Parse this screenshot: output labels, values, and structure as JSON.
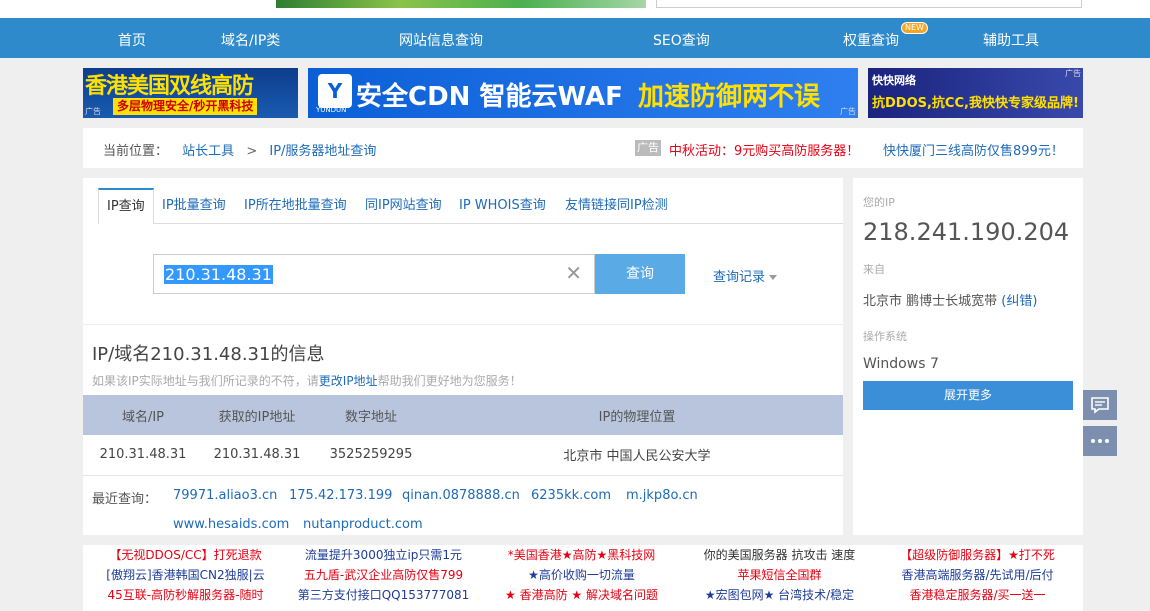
{
  "nav": {
    "items": [
      "首页",
      "域名/IP类",
      "网站信息查询",
      "SEO查询",
      "权重查询",
      "辅助工具"
    ],
    "new_badge": "NEW"
  },
  "ads": {
    "ad1_line1": "香港美国双线高防",
    "ad1_line2": "多层物理安全/秒开黑科技",
    "ad2_logo_text": "YUNDUN",
    "ad2_line1": "安全CDN 智能云WAF",
    "ad2_line2": "加速防御两不误",
    "ad3_brand": "快快网络",
    "ad3_line1": "抗DDOS,抗CC,我快快专家级品牌!",
    "ad_mark": "广告"
  },
  "breadcrumb": {
    "prefix": "当前位置：",
    "home": "站长工具",
    "sep": ">",
    "current": "IP/服务器地址查询",
    "ad_tag": "广告",
    "ad_text1": "中秋活动：9元购买高防服务器！",
    "ad_text2": "快快厦门三线高防仅售899元！"
  },
  "tabs": [
    "IP查询",
    "IP批量查询",
    "IP所在地批量查询",
    "同IP网站查询",
    "IP WHOIS查询",
    "友情链接同IP检测"
  ],
  "search": {
    "value": "210.31.48.31",
    "clear": "✕",
    "button": "查询",
    "history": "查询记录"
  },
  "info": {
    "title": "IP/域名210.31.48.31的信息",
    "note_before": "如果该IP实际地址与我们所记录的不符，请",
    "note_link": "更改IP地址",
    "note_after": "帮助我们更好地为您服务！"
  },
  "table": {
    "headers": [
      "域名/IP",
      "获取的IP地址",
      "数字地址",
      "IP的物理位置"
    ],
    "row": [
      "210.31.48.31",
      "210.31.48.31",
      "3525259295",
      "北京市 中国人民公安大学"
    ]
  },
  "recent": {
    "label": "最近查询：",
    "items": [
      "79971.aliao3.cn",
      "175.42.173.199",
      "qinan.0878888.cn",
      "6235kk.com",
      "m.jkp8o.cn",
      "www.hesaids.com",
      "nutanproduct.com"
    ]
  },
  "side": {
    "ip_label": "您的IP",
    "ip": "218.241.190.204",
    "from_label": "来自",
    "location": "北京市 鹏博士长城宽带",
    "correct": "(纠错)",
    "os_label": "操作系统",
    "os": "Windows 7",
    "more": "展开更多"
  },
  "bottom": {
    "col1": [
      "【无视DDOS/CC】打死退款",
      "[傲翔云]香港韩国CN2独服|云",
      "45互联-高防秒解服务器-随时"
    ],
    "col2": [
      "流量提升3000独立ip只需1元",
      "五九盾-武汉企业高防仅售799",
      "第三方支付接口QQ153777081"
    ],
    "col3": [
      "*美国香港★高防★黑科技网",
      "★高价收购一切流量",
      "★ 香港高防 ★ 解决域名问题"
    ],
    "col4": [
      "你的美国服务器 抗攻击 速度",
      "苹果短信全国群",
      "★宏图包网★ 台湾技术/稳定"
    ],
    "col5": [
      "【超级防御服务器】★打不死",
      "香港高端服务器/先试用/后付",
      "香港稳定服务器/买一送一"
    ]
  },
  "colors": {
    "nav": "#2e8acb",
    "accent_red": "#e60012",
    "link": "#1e6bb8"
  }
}
